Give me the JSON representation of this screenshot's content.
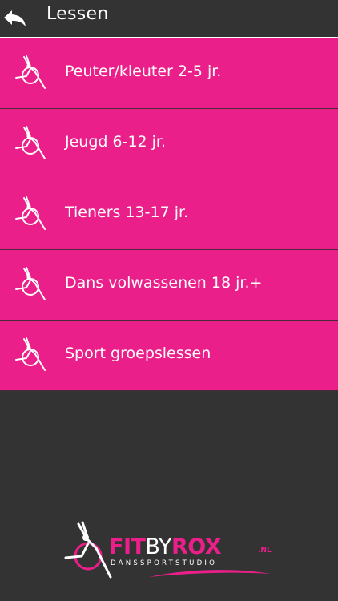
{
  "header": {
    "title": "Lessen",
    "back_icon": "back-arrow-icon"
  },
  "lessons": [
    {
      "label": "Peuter/kleuter 2-5 jr.",
      "icon": "dancer-icon"
    },
    {
      "label": "Jeugd 6-12 jr.",
      "icon": "dancer-icon"
    },
    {
      "label": "Tieners 13-17 jr.",
      "icon": "dancer-icon"
    },
    {
      "label": "Dans volwassenen 18 jr.+",
      "icon": "dancer-icon"
    },
    {
      "label": "Sport groepslessen",
      "icon": "dancer-icon"
    }
  ],
  "logo": {
    "fit": "FIT",
    "by": "BY",
    "rox": "ROX",
    "nl": ".NL",
    "subtitle": "DANSSPORTSTUDIO"
  },
  "colors": {
    "accent": "#ea1f8a",
    "background": "#333333",
    "text": "#ffffff"
  }
}
